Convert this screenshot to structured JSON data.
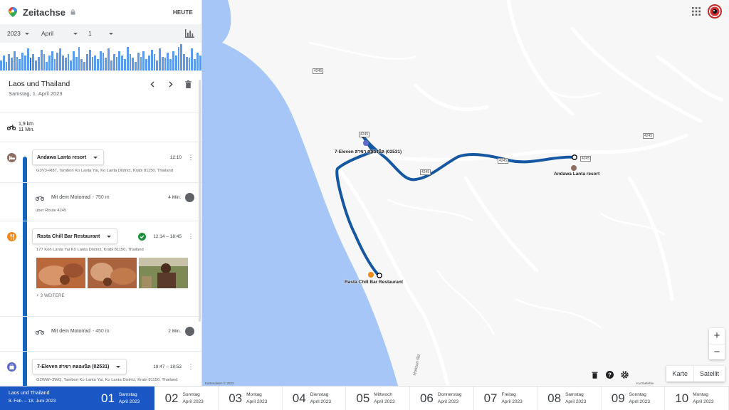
{
  "header": {
    "title": "Zeitachse",
    "today_label": "HEUTE"
  },
  "date_selector": {
    "year": "2023",
    "month": "April",
    "day": "1"
  },
  "histogram": {
    "values": [
      0.35,
      0.55,
      0.3,
      0.6,
      0.45,
      0.7,
      0.5,
      0.4,
      0.65,
      0.55,
      0.8,
      0.45,
      0.6,
      0.35,
      0.5,
      0.75,
      0.6,
      0.3,
      0.55,
      0.7,
      0.4,
      0.65,
      0.8,
      0.55,
      0.45,
      0.6,
      0.35,
      0.7,
      0.5,
      0.85,
      0.4,
      0.3,
      0.6,
      0.75,
      0.5,
      0.55,
      0.4,
      0.7,
      0.65,
      0.45,
      0.8,
      0.35,
      0.6,
      0.5,
      0.7,
      0.55,
      0.4,
      0.85,
      0.6,
      0.45,
      0.3,
      0.65,
      0.5,
      0.7,
      0.4,
      0.55,
      0.75,
      0.6,
      0.35,
      0.8,
      0.5,
      0.45,
      0.65,
      0.4,
      0.7,
      0.55,
      0.85,
      0.95,
      0.6,
      0.5,
      0.45,
      0.8,
      0.4,
      0.65,
      0.55
    ],
    "selected_index": 11
  },
  "trip": {
    "title": "Laos und Thailand",
    "date": "Samstag, 1. April 2023",
    "summary_distance": "1,9 km",
    "summary_duration": "11 Min."
  },
  "timeline": {
    "place1": {
      "name": "Andawa Lanta resort",
      "time": "12:10",
      "address": "G3V3+R87, Tambon Ko Lanta Yai, Ko Lanta District, Krabi 81150, Thailand"
    },
    "move1": {
      "mode": "Mit dem Motorrad",
      "distance": "- 750 m",
      "duration": "4 Min.",
      "via": "über Route 4245"
    },
    "place2": {
      "name": "Rasta Chill Bar Restaurant",
      "time": "12:14 – 18:45",
      "address": "177 Koh Lanta Yai Ko Lanta District, Krabi 81150, Thailand",
      "more": "+ 3 WEITERE"
    },
    "move2": {
      "mode": "Mit dem Motorrad",
      "distance": "- 450 m",
      "duration": "2 Min."
    },
    "place3": {
      "name": "7-Eleven สาขา คลองนิล (02531)",
      "time": "18:47 – 18:52",
      "address": "G2WW+3WQ, Tambon Ko Lanta Yai, Ko Lanta District, Krabi 81150, Thailand"
    }
  },
  "map": {
    "labels": {
      "seven_eleven": "7-Eleven สาขา คลองนิล (02531)",
      "andawa": "Andawa Lanta resort",
      "rasta": "Rasta Chill Bar Restaurant",
      "street": "Horizon Rd"
    },
    "road_tag": "4245",
    "view_map": "Karte",
    "view_satellite": "Satellit",
    "attribution": "Kartendaten © 2023",
    "shortcuts": "Kurzbefehle",
    "colors": {
      "water": "#a5c6f7",
      "route": "#1557a0",
      "land": "#f7f7f7"
    }
  },
  "bottom": {
    "range_title": "Laos und Thailand",
    "range_dates": "8. Feb. – 18. Juni 2023",
    "days": [
      {
        "num": "01",
        "weekday": "Samstag",
        "month": "April 2023"
      },
      {
        "num": "02",
        "weekday": "Sonntag",
        "month": "April 2023"
      },
      {
        "num": "03",
        "weekday": "Montag",
        "month": "April 2023"
      },
      {
        "num": "04",
        "weekday": "Dienstag",
        "month": "April 2023"
      },
      {
        "num": "05",
        "weekday": "Mittwoch",
        "month": "April 2023"
      },
      {
        "num": "06",
        "weekday": "Donnerstag",
        "month": "April 2023"
      },
      {
        "num": "07",
        "weekday": "Freitag",
        "month": "April 2023"
      },
      {
        "num": "08",
        "weekday": "Samstag",
        "month": "April 2023"
      },
      {
        "num": "09",
        "weekday": "Sonntag",
        "month": "April 2023"
      },
      {
        "num": "10",
        "weekday": "Montag",
        "month": "April 2023"
      }
    ]
  }
}
